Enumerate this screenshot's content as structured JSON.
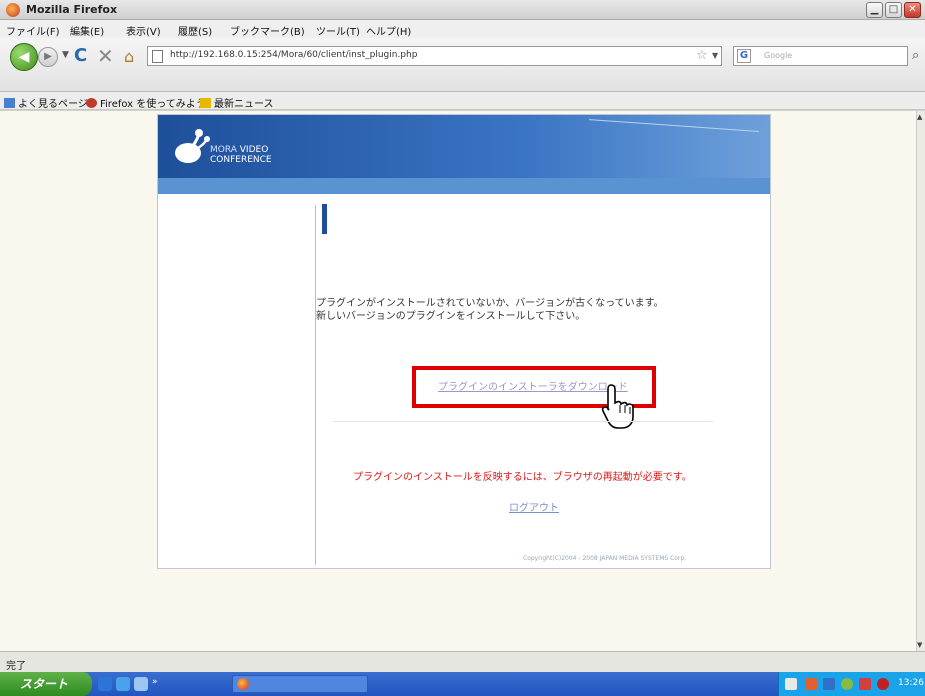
{
  "window": {
    "title": "Mozilla Firefox",
    "minimize_glyph": "▁",
    "maximize_glyph": "□",
    "close_glyph": "✕"
  },
  "menu": [
    "ファイル(F)",
    "編集(E)",
    "表示(V)",
    "履歴(S)",
    "ブックマーク(B)",
    "ツール(T)",
    "ヘルプ(H)"
  ],
  "nav": {
    "back_glyph": "◀",
    "forward_glyph": "▶",
    "dropdown_glyph": "▼",
    "reload_glyph": "C",
    "stop_glyph": "✕",
    "home_glyph": "⌂",
    "url": "http://192.168.0.15:254/Mora/60/client/inst_plugin.php",
    "star_glyph": "☆",
    "search_placeholder": "Google",
    "search_engine_glyph": "G",
    "search_go_glyph": "⌕"
  },
  "bookmarks": [
    {
      "label": "よく見るページ",
      "icon": "bookmark-icon",
      "color": "#4a7fd0"
    },
    {
      "label": "Firefox を使ってみよう",
      "icon": "firefox-icon",
      "color": "#c0392b"
    },
    {
      "label": "最新ニュース",
      "icon": "rss-folder-icon",
      "color": "#e6b800"
    }
  ],
  "page": {
    "logo_line1_a": "MORA",
    "logo_line1_b": " VIDEO",
    "logo_line2": "CONFERENCE",
    "message_line1": "プラグインがインストールされていないか、バージョンが古くなっています。",
    "message_line2": "新しいバージョンのプラグインをインストールして下さい。",
    "download_link": "プラグインのインストーラをダウンロード",
    "restart_notice": "プラグインのインストールを反映するには、ブラウザの再起動が必要です。",
    "logout_link": "ログアウト",
    "copyright": "Copyright(C)2004 - 2008 JAPAN MEDIA SYSTEMS Corp."
  },
  "status": {
    "text": "完了"
  },
  "taskbar": {
    "start_label": "スタート",
    "clock": "13:26"
  },
  "colors": {
    "highlight": "#e00000",
    "banner": "#1e4f9a"
  }
}
